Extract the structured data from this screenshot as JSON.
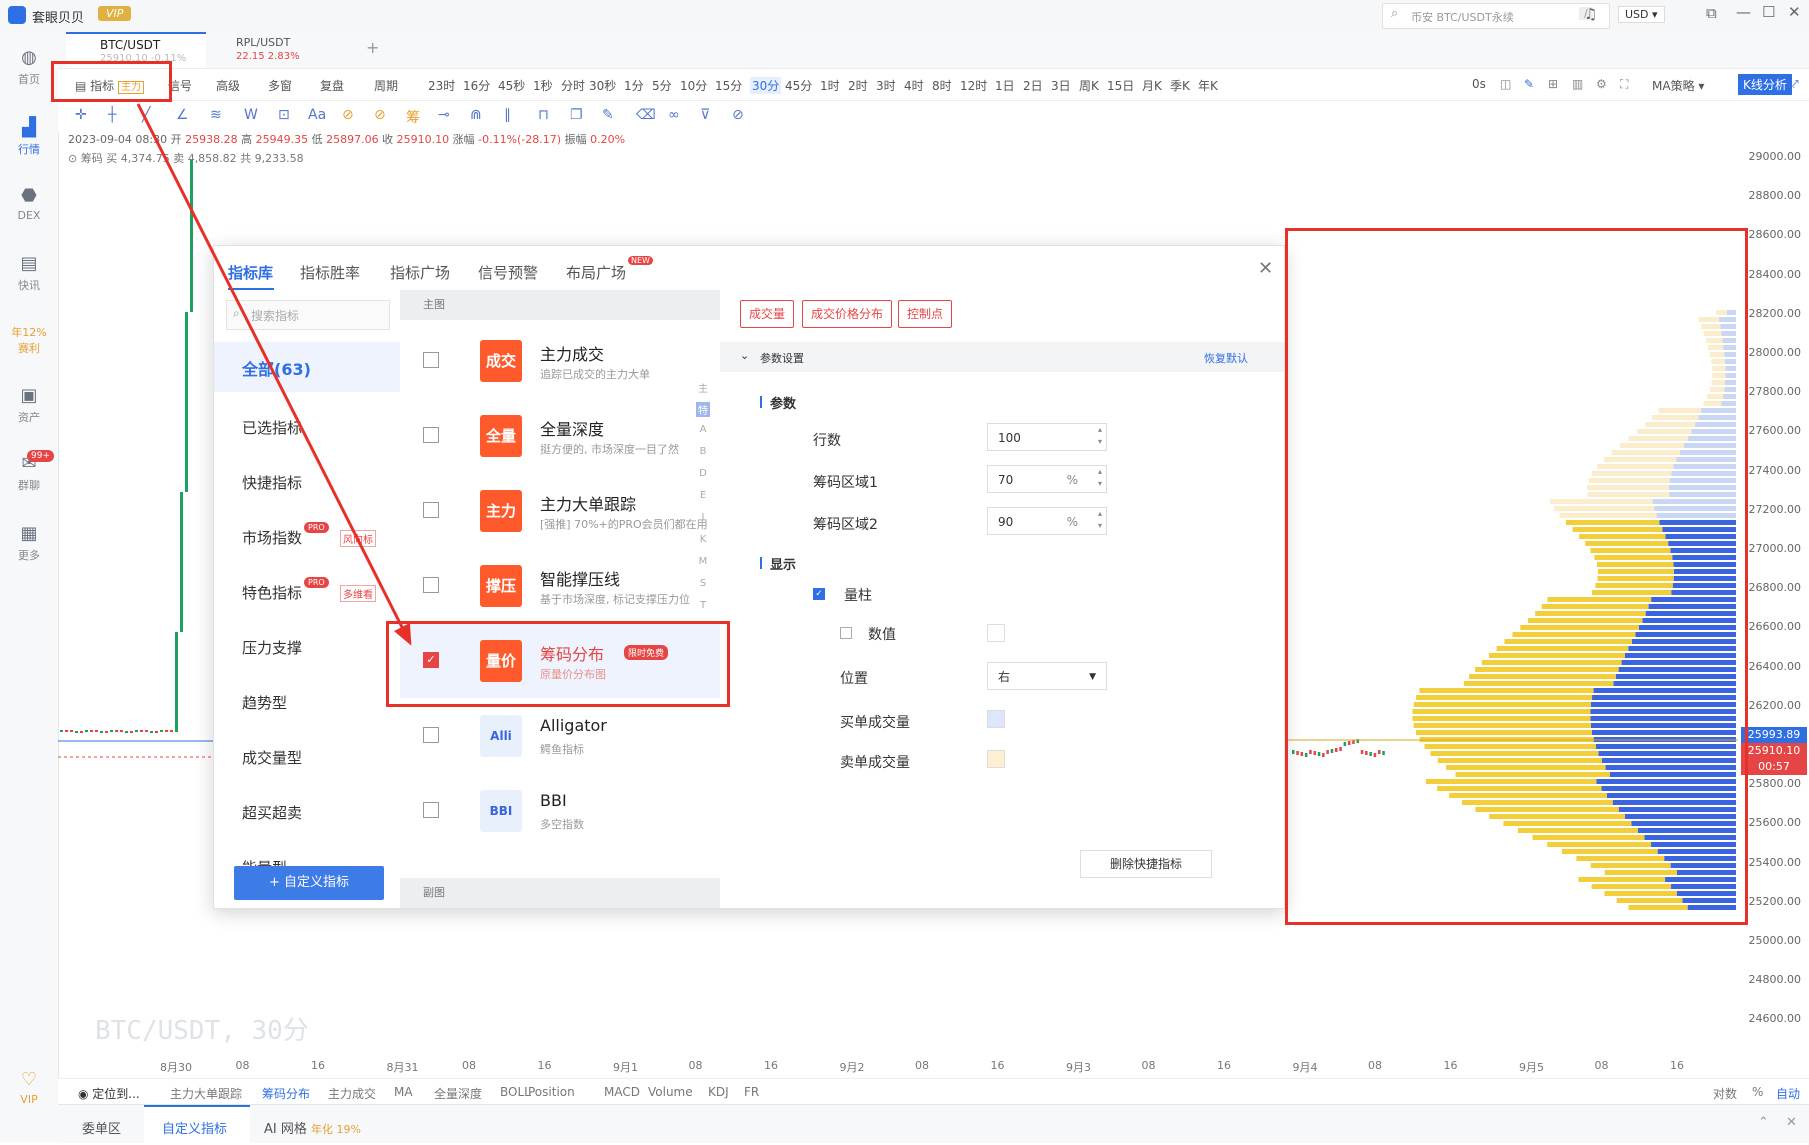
{
  "app": {
    "name": "套眼贝贝",
    "vip_label": "VIP"
  },
  "search": {
    "placeholder": "币安 BTC/USDT永续",
    "shortcut": "/"
  },
  "currency": "USD",
  "left_nav": [
    {
      "label": "首页",
      "icon": "globe-icon"
    },
    {
      "label": "行情",
      "icon": "chart-bars-icon"
    },
    {
      "label": "DEX",
      "icon": "dex-icon"
    },
    {
      "label": "快讯",
      "icon": "news-icon"
    },
    {
      "label": "年12%",
      "sub": "赛利",
      "icon": "percent-icon"
    },
    {
      "label": "资产",
      "icon": "wallet-icon"
    },
    {
      "label": "群聊",
      "icon": "chat-icon",
      "badge": "99+"
    },
    {
      "label": "更多",
      "icon": "grid-icon"
    },
    {
      "label": "VIP",
      "icon": "vip-icon"
    }
  ],
  "tabs": [
    {
      "label": "BTC/USDT",
      "sub": "25910.10 -0.11%",
      "active": true
    },
    {
      "label": "RPL/USDT",
      "sub": "22.15 2.83%"
    }
  ],
  "toolbar": {
    "indicator_label": "指标",
    "indicator_tag": "主力",
    "items": [
      "信号",
      "高级",
      "多窗",
      "复盘",
      "周期"
    ],
    "intervals": [
      "23时",
      "16分",
      "45秒",
      "1秒",
      "分时",
      "30秒",
      "1分",
      "5分",
      "10分",
      "15分",
      "30分",
      "45分",
      "1时",
      "2时",
      "3时",
      "4时",
      "8时",
      "12时",
      "1日",
      "2日",
      "3日",
      "周K",
      "15日",
      "月K",
      "季K",
      "年K"
    ],
    "active_interval": "30分",
    "right": [
      "0s",
      "MA策略",
      "K线分析"
    ]
  },
  "ohlc": {
    "date": "2023-09-04 08:30",
    "open_label": "开",
    "open": "25938.28",
    "high_label": "高",
    "high": "25949.35",
    "low_label": "低",
    "low": "25897.06",
    "close_label": "收",
    "close": "25910.10",
    "change_label": "涨幅",
    "change": "-0.11%(-28.17)",
    "amp_label": "振幅",
    "amp": "0.20%",
    "chips_line": "筹码 买 4,374.75 卖 4,858.82 共 9,233.58"
  },
  "price_axis": [
    "29000.00",
    "28800.00",
    "28600.00",
    "28400.00",
    "28200.00",
    "28000.00",
    "27800.00",
    "27600.00",
    "27400.00",
    "27200.00",
    "27000.00",
    "26800.00",
    "26600.00",
    "26400.00",
    "26200.00",
    "26000.00",
    "25800.00",
    "25600.00",
    "25400.00",
    "25200.00",
    "25000.00",
    "24800.00",
    "24600.00"
  ],
  "price_tags": {
    "current": "25993.89",
    "last": "25910.10",
    "countdown": "00:57"
  },
  "time_axis": [
    "8月30",
    "08",
    "16",
    "8月31",
    "08",
    "16",
    "9月1",
    "08",
    "16",
    "9月2",
    "08",
    "16",
    "9月3",
    "08",
    "16",
    "9月4",
    "08",
    "16",
    "9月5",
    "08",
    "16"
  ],
  "watermark": "BTC/USDT, 30分",
  "bottom_bar": {
    "locate": "定位到...",
    "indicators": [
      "主力大单跟踪",
      "筹码分布",
      "主力成交",
      "MA",
      "全量深度",
      "BOLL"
    ],
    "active": "筹码分布",
    "sub_indicators": [
      "Position",
      "MACD",
      "Volume",
      "KDJ",
      "FR"
    ],
    "right": [
      "对数",
      "%",
      "自动"
    ]
  },
  "footer_tabs": [
    {
      "label": "委单区"
    },
    {
      "label": "自定义指标",
      "active": true
    },
    {
      "label": "AI 网格",
      "tag": "年化 19%"
    }
  ],
  "dialog": {
    "tabs": [
      "指标库",
      "指标胜率",
      "指标广场",
      "信号预警",
      "布局广场"
    ],
    "new_badge": "NEW",
    "search_placeholder": "搜索指标",
    "categories": [
      {
        "label": "全部(63)",
        "active": true
      },
      {
        "label": "已选指标"
      },
      {
        "label": "快捷指标"
      },
      {
        "label": "市场指数",
        "badge": "PRO",
        "tag": "风向标"
      },
      {
        "label": "特色指标",
        "badge": "PRO",
        "tag": "多维看"
      },
      {
        "label": "压力支撑"
      },
      {
        "label": "趋势型"
      },
      {
        "label": "成交量型"
      },
      {
        "label": "超买超卖"
      },
      {
        "label": "能量型"
      }
    ],
    "custom_button": "+ 自定义指标",
    "section_main": "主图",
    "section_sub": "副图",
    "alpha_index": [
      "主",
      "特",
      "A",
      "B",
      "D",
      "E",
      "I",
      "K",
      "M",
      "S",
      "T"
    ],
    "indicators": [
      {
        "icon": "成交",
        "name": "主力成交",
        "desc": "追踪已成交的主力大单",
        "checked": false,
        "color": "#ff5a2c"
      },
      {
        "icon": "全量",
        "name": "全量深度",
        "desc": "挺方便的, 市场深度一目了然",
        "checked": false,
        "color": "#ff5a2c"
      },
      {
        "icon": "主力",
        "name": "主力大单跟踪",
        "desc": "[强推] 70%+的PRO会员们都在用",
        "checked": false,
        "color": "#ff5a2c"
      },
      {
        "icon": "撑压",
        "name": "智能撑压线",
        "desc": "基于市场深度, 标记支撑压力位",
        "checked": false,
        "color": "#ff5a2c"
      },
      {
        "icon": "量价",
        "name": "筹码分布",
        "desc": "原量价分布图",
        "checked": true,
        "color": "#ff5a2c",
        "tag": "限时免费"
      },
      {
        "icon": "Alli",
        "name": "Alligator",
        "desc": "鳄鱼指标",
        "checked": false,
        "color": "#e8f0fc"
      },
      {
        "icon": "BBI",
        "name": "BBI",
        "desc": "多空指数",
        "checked": false,
        "color": "#e8f0fc"
      }
    ],
    "chips": [
      "成交量",
      "成交价格分布",
      "控制点"
    ],
    "params_header": "参数设置",
    "restore_default": "恢复默认",
    "params_title": "参数",
    "params": [
      {
        "label": "行数",
        "value": "100",
        "unit": ""
      },
      {
        "label": "筹码区域1",
        "value": "70",
        "unit": "%"
      },
      {
        "label": "筹码区域2",
        "value": "90",
        "unit": "%"
      }
    ],
    "display_title": "显示",
    "display": {
      "bars_label": "量柱",
      "bars_checked": true,
      "values_label": "数值",
      "values_checked": false,
      "position_label": "位置",
      "position_value": "右",
      "buy_label": "买单成交量",
      "buy_color": "#dde6fb",
      "sell_label": "卖单成交量",
      "sell_color": "#fdf0d2"
    },
    "delete_button": "删除快捷指标"
  },
  "colors": {
    "accent": "#2f6fe4",
    "red_annotation": "#e8302a",
    "buy_blue": "#3a64e0",
    "sell_yellow": "#f2cf3a"
  }
}
